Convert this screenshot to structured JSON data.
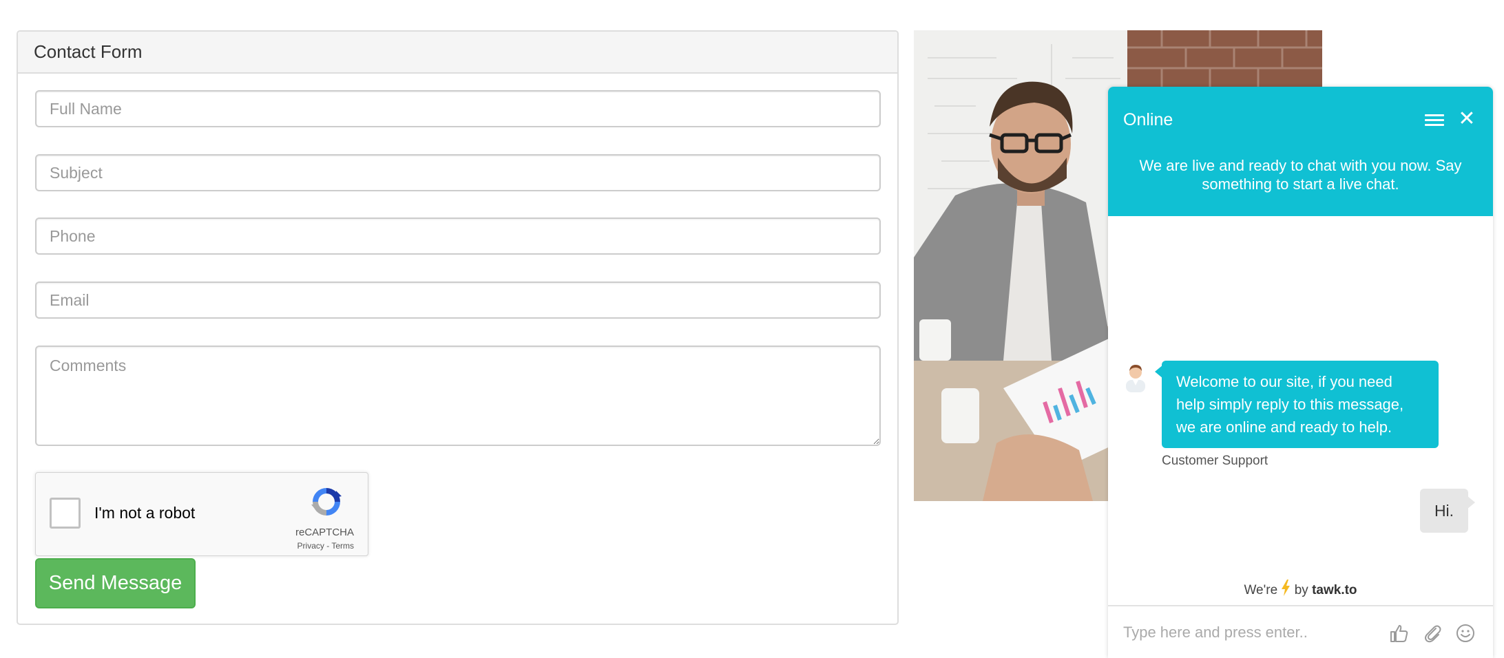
{
  "form": {
    "heading": "Contact Form",
    "fields": {
      "full_name": {
        "placeholder": "Full Name",
        "value": ""
      },
      "subject": {
        "placeholder": "Subject",
        "value": ""
      },
      "phone": {
        "placeholder": "Phone",
        "value": ""
      },
      "email": {
        "placeholder": "Email",
        "value": ""
      },
      "comments": {
        "placeholder": "Comments",
        "value": ""
      }
    },
    "captcha": {
      "label": "I'm not a robot",
      "brand": "reCAPTCHA",
      "links": "Privacy - Terms"
    },
    "submit_label": "Send Message",
    "submit_color": "#5cb85c"
  },
  "photo": {
    "icon": "office-photo-man-with-glasses"
  },
  "chat": {
    "status": "Online",
    "intro": "We are live and ready to chat with you now. Say something to start a live chat.",
    "accent": "#10c0d3",
    "messages": [
      {
        "from": "agent",
        "text": "Welcome to our site, if you need help simply reply to this message, we are online and ready to help.",
        "sender": "Customer Support"
      },
      {
        "from": "visitor",
        "text": "Hi."
      }
    ],
    "powered": {
      "prefix": "We're",
      "middle": "by",
      "brand": "tawk.to"
    },
    "composer_placeholder": "Type here and press enter..",
    "icons": [
      "menu-icon",
      "close-icon",
      "thumbs-up-icon",
      "paperclip-icon",
      "emoji-icon",
      "bolt-icon",
      "agent-avatar-icon"
    ]
  }
}
